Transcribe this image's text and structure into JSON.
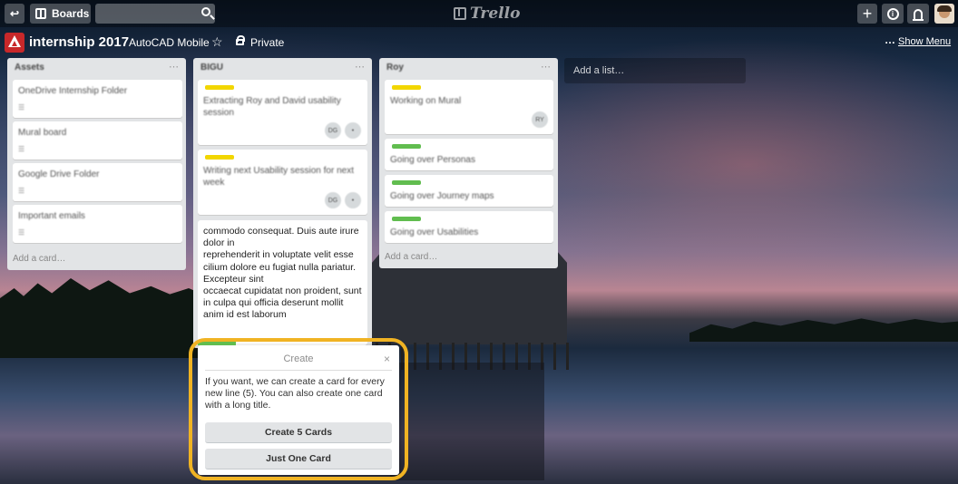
{
  "header": {
    "boards_label": "Boards",
    "search_value": "",
    "logo_text": "Trello"
  },
  "board": {
    "title": "internship 2017",
    "team": "AutoCAD Mobile",
    "privacy": "Private",
    "show_menu": "Show Menu",
    "menu_dots": "…"
  },
  "lists": [
    {
      "name": "Assets",
      "cards": [
        {
          "title": "OneDrive Internship Folder",
          "badge": "☰"
        },
        {
          "title": "Mural board",
          "badge": "☰"
        },
        {
          "title": "Google Drive Folder",
          "badge": "☰"
        },
        {
          "title": "Important emails",
          "badge": "☰"
        }
      ],
      "add_card": "Add a card…"
    },
    {
      "name": "BIGU",
      "cards": [
        {
          "title_line1": "Extracting Roy and David usability",
          "title_line2": "session",
          "members": [
            "DG",
            "•"
          ]
        },
        {
          "title_line1": "Writing next Usability session for next",
          "title_line2": "week",
          "members": [
            "DG",
            "•"
          ]
        }
      ],
      "composer_text": "commodo consequat. Duis aute irure\ndolor in\nreprehenderit in voluptate velit esse\ncilium dolore eu fugiat nulla pariatur.\nExcepteur sint\noccaecat cupidatat non proident, sunt\nin culpa qui officia deserunt mollit\nanim id est laborum"
    },
    {
      "name": "Roy",
      "cards": [
        {
          "title": "Working on Mural",
          "member": "RY"
        },
        {
          "title": "Going over Personas"
        },
        {
          "title": "Going over Journey maps"
        },
        {
          "title": "Going over Usabilities"
        }
      ],
      "add_card": "Add a card…"
    }
  ],
  "add_list": "Add a list…",
  "popup": {
    "title": "Create",
    "close": "×",
    "body": "If you want, we can create a card for every new line (5). You can also create one card with a long title.",
    "create_multiple": "Create 5 Cards",
    "create_one": "Just One Card"
  },
  "colors": {
    "label_yellow": "#f2d600",
    "label_green": "#61bd4f",
    "highlight": "#f0b323",
    "board_icon": "#c8282a"
  }
}
